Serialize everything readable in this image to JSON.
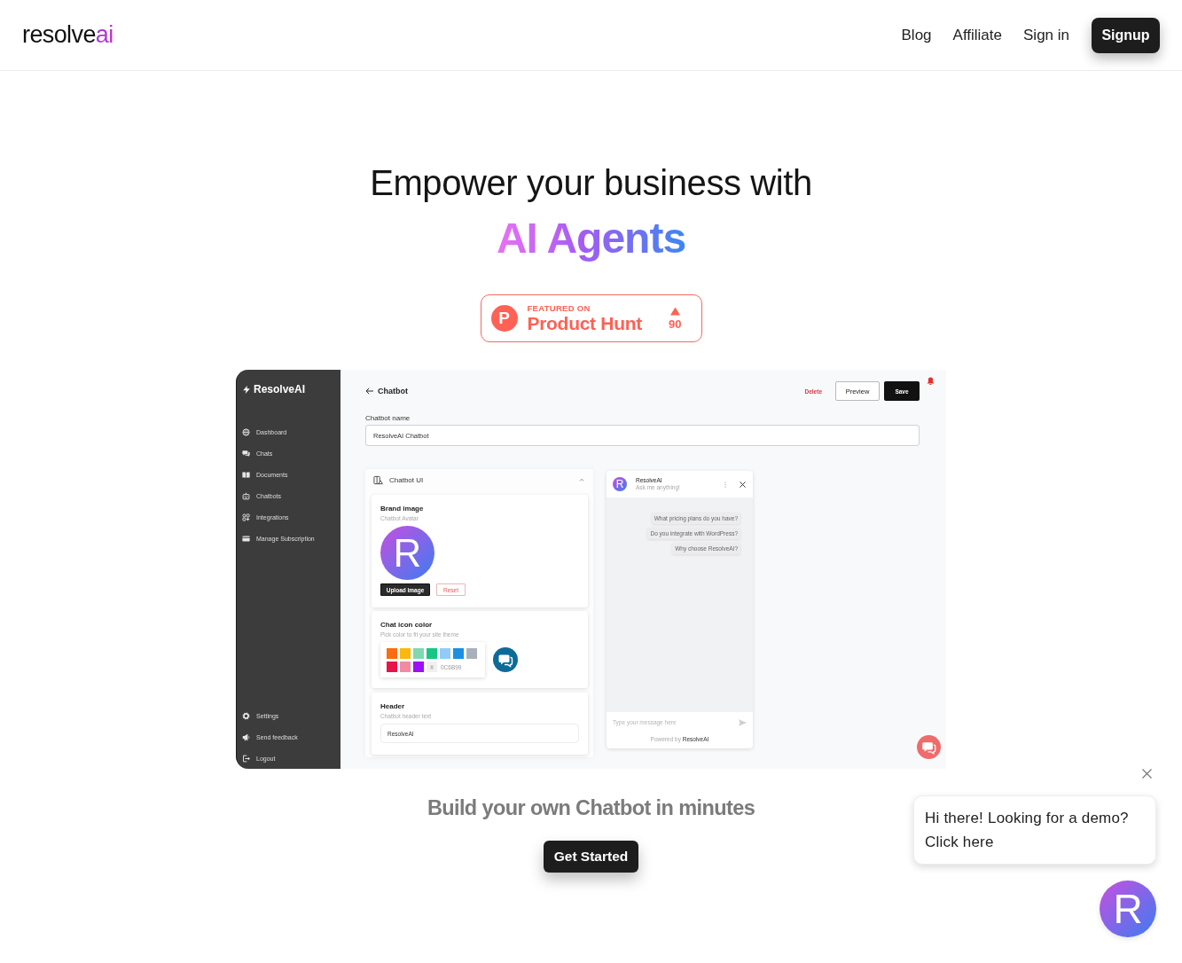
{
  "header": {
    "logo": {
      "main": "resolve",
      "accent": "ai"
    },
    "nav": [
      {
        "label": "Blog"
      },
      {
        "label": "Affiliate"
      },
      {
        "label": "Sign in"
      }
    ],
    "signup": "Signup"
  },
  "hero": {
    "title": "Empower your business with",
    "highlight": "AI Agents",
    "badge": {
      "logo_letter": "P",
      "eyebrow": "FEATURED ON",
      "name": "Product Hunt",
      "votes": "90"
    }
  },
  "app_preview": {
    "sidebar": {
      "brand": "ResolveAI",
      "items": [
        {
          "label": "Dashboard"
        },
        {
          "label": "Chats"
        },
        {
          "label": "Documents"
        },
        {
          "label": "Chatbots"
        },
        {
          "label": "Integrations"
        },
        {
          "label": "Manage Subscription"
        }
      ],
      "footer_items": [
        {
          "label": "Settings"
        },
        {
          "label": "Send feedback"
        },
        {
          "label": "Logout"
        }
      ]
    },
    "topbar": {
      "title": "Chatbot",
      "delete": "Delete",
      "preview": "Preview",
      "save": "Save"
    },
    "name_field": {
      "label": "Chatbot name",
      "value": "ResolveAI Chatbot"
    },
    "settings_panel": {
      "title": "Chatbot UI",
      "expanded": true,
      "sections": [
        {
          "kind": "image",
          "title": "Brand image",
          "subtitle": "Chatbot Avatar",
          "avatar_letter": "R",
          "upload": "Upload image",
          "reset": "Reset"
        },
        {
          "kind": "color",
          "title": "Chat icon color",
          "subtitle": "Pick color to fit your site theme",
          "swatches": [
            {
              "color": "#fb6d10"
            },
            {
              "color": "#fbb80f"
            },
            {
              "color": "#7fd8b0"
            },
            {
              "color": "#16c784"
            },
            {
              "color": "#90ccf8"
            },
            {
              "color": "#1a8fe3"
            },
            {
              "color": "#a8b0bb"
            },
            {
              "color": "#e8134b"
            },
            {
              "color": "#f28aa6"
            },
            {
              "color": "#9b10f5"
            }
          ],
          "hash": "#",
          "hex_value": "0C6B99"
        },
        {
          "kind": "text",
          "title": "Header",
          "subtitle": "Chatbot header text",
          "value": "ResolveAI"
        }
      ]
    },
    "chat_preview": {
      "avatar_letter": "R",
      "name": "ResolveAI",
      "subtitle": "Ask me anything!",
      "suggestions": [
        "What pricing plans do you have?",
        "Do you integrate with WordPress?",
        "Why choose ResolveAI?"
      ],
      "placeholder": "Type your message here",
      "footer": "Powered by **ResolveAI**"
    }
  },
  "cta": {
    "heading": "Build your own Chatbot in minutes",
    "button": "Get Started"
  },
  "demo_popup": {
    "message": "Hi there! Looking for a demo? Click here",
    "launcher_letter": "R"
  }
}
